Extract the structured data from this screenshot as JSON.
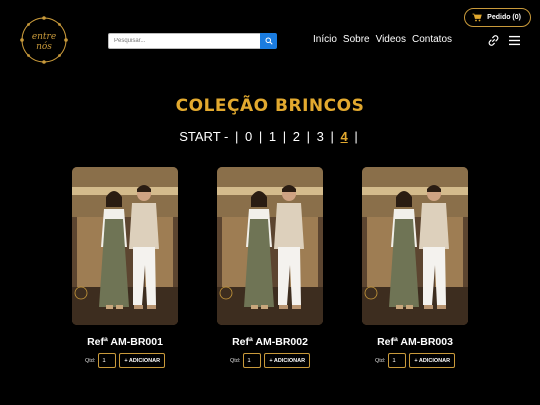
{
  "header": {
    "logo_text": "entre nós",
    "cart_label": "Pedido (0)",
    "search_placeholder": "Pesquisar...",
    "nav": [
      "Início",
      "Sobre",
      "Videos",
      "Contatos"
    ]
  },
  "main": {
    "collection_title": "COLEÇÃO BRINCOS",
    "pagination": {
      "start_label": "START -",
      "pages": [
        "0",
        "1",
        "2",
        "3",
        "4"
      ],
      "active_page": "4"
    },
    "products": [
      {
        "ref": "Refª AM-BR001",
        "qty_label": "Qtd:",
        "qty_value": "1",
        "add_label": "+ ADICIONAR"
      },
      {
        "ref": "Refª AM-BR002",
        "qty_label": "Qtd:",
        "qty_value": "1",
        "add_label": "+ ADICIONAR"
      },
      {
        "ref": "Refª AM-BR003",
        "qty_label": "Qtd:",
        "qty_value": "1",
        "add_label": "+ ADICIONAR"
      }
    ]
  },
  "colors": {
    "accent": "#e2a92f",
    "border": "#c99a3b",
    "search_button": "#1a7ce0",
    "background": "#000000"
  },
  "icons": [
    "logo-icon",
    "cart-icon",
    "search-icon",
    "link-icon",
    "menu-icon"
  ]
}
